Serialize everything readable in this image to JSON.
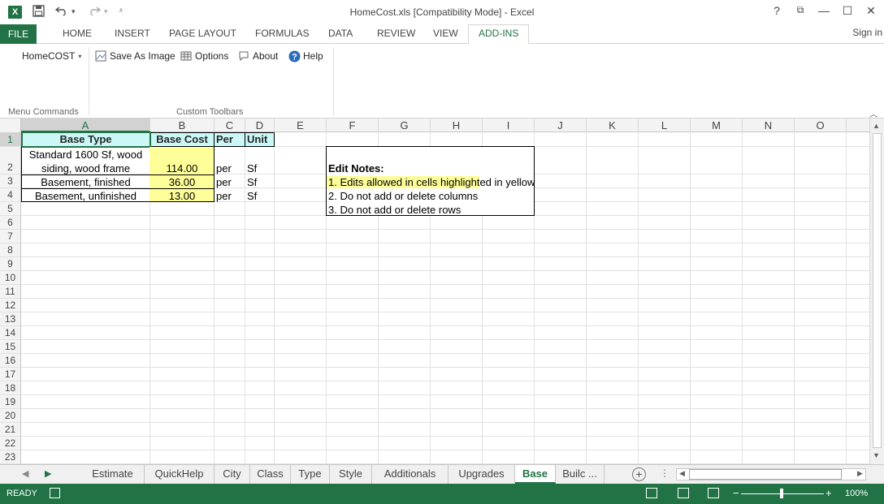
{
  "window": {
    "title": "HomeCost.xls  [Compatibility Mode] - Excel",
    "app_logo": "X",
    "help": "?",
    "restore": "⧉",
    "minimize": "—",
    "maximize": "☐",
    "close": "✕"
  },
  "tabs": {
    "file": "FILE",
    "home": "HOME",
    "insert": "INSERT",
    "page_layout": "PAGE LAYOUT",
    "formulas": "FORMULAS",
    "data": "DATA",
    "review": "REVIEW",
    "view": "VIEW",
    "addins": "ADD-INS",
    "signin": "Sign in"
  },
  "ribbon": {
    "homecost": "HomeCOST",
    "save_as_image": "Save As Image",
    "options": "Options",
    "about": "About",
    "help": "Help",
    "group_menu": "Menu Commands",
    "group_toolbars": "Custom Toolbars"
  },
  "columns": [
    "A",
    "B",
    "C",
    "D",
    "E",
    "F",
    "G",
    "H",
    "I",
    "J",
    "K",
    "L",
    "M",
    "N",
    "O"
  ],
  "rows": [
    "1",
    "2",
    "3",
    "4",
    "5",
    "6",
    "7",
    "8",
    "9",
    "10",
    "11",
    "12",
    "13",
    "14",
    "15",
    "16",
    "17",
    "18",
    "19",
    "20",
    "21",
    "22",
    "23"
  ],
  "sheet": {
    "header": {
      "base_type": "Base Type",
      "base_cost": "Base Cost",
      "per": "Per",
      "unit": "Unit"
    },
    "rows": [
      {
        "type_line1": "Standard 1600 Sf, wood",
        "type_line2": "siding, wood frame",
        "cost": "114.00",
        "per": "per",
        "unit": "Sf"
      },
      {
        "type": "Basement, finished",
        "cost": "36.00",
        "per": "per",
        "unit": "Sf"
      },
      {
        "type": "Basement, unfinished",
        "cost": "13.00",
        "per": "per",
        "unit": "Sf"
      }
    ],
    "notes": {
      "title": "Edit Notes:",
      "note1_highlight": "1. Edits allowed in cells highlight",
      "note1_rest": "ed in yellow",
      "note2": "2. Do not add or delete columns",
      "note3": "3. Do not add or delete rows"
    }
  },
  "sheet_tabs": [
    "Estimate",
    "QuickHelp",
    "City",
    "Class",
    "Type",
    "Style",
    "Additionals",
    "Upgrades",
    "Base",
    "Builc ..."
  ],
  "active_sheet": "Base",
  "status": {
    "ready": "READY",
    "zoom": "100%",
    "zoom_out": "−",
    "zoom_in": "+"
  },
  "colors": {
    "excel_green": "#217346",
    "header_cyan": "#ccf7f7",
    "edit_yellow": "#ffff99"
  }
}
